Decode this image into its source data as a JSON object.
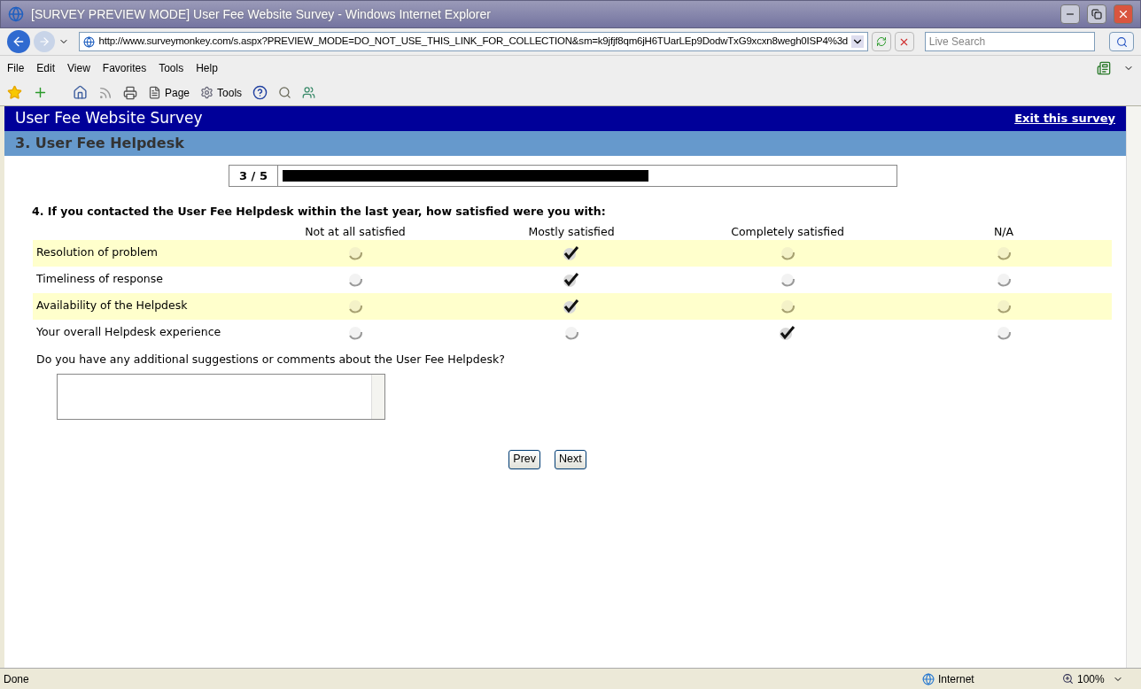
{
  "window": {
    "title": "[SURVEY PREVIEW MODE] User Fee Website Survey - Windows Internet Explorer"
  },
  "address": {
    "url": "http://www.surveymonkey.com/s.aspx?PREVIEW_MODE=DO_NOT_USE_THIS_LINK_FOR_COLLECTION&sm=k9jfjf8qm6jH6TUarLEp9DodwTxG9xcxn8wegh0ISP4%3d"
  },
  "search": {
    "placeholder": "Live Search"
  },
  "menu": [
    "File",
    "Edit",
    "View",
    "Favorites",
    "Tools",
    "Help"
  ],
  "toolbar": [
    {
      "label": "Page"
    },
    {
      "label": "Tools"
    }
  ],
  "survey": {
    "title": "User Fee Website Survey",
    "exit_link": "Exit this survey",
    "section": "3. User Fee Helpdesk",
    "progress": {
      "text": "3 / 5",
      "level": 0.6
    },
    "question": "4. If you contacted the User Fee Helpdesk within the last year, how satisfied were you with:",
    "columns": [
      "Not at all satisfied",
      "Mostly satisfied",
      "Completely satisfied",
      "N/A"
    ],
    "rows": [
      {
        "label": "Resolution of problem",
        "choices": [
          {
            "selected": false
          },
          {
            "selected": true
          },
          {
            "selected": false
          },
          {
            "selected": false
          }
        ]
      },
      {
        "label": "Timeliness of response",
        "choices": [
          {
            "selected": false
          },
          {
            "selected": true
          },
          {
            "selected": false
          },
          {
            "selected": false
          }
        ]
      },
      {
        "label": "Availability of the Helpdesk",
        "choices": [
          {
            "selected": false
          },
          {
            "selected": true
          },
          {
            "selected": false
          },
          {
            "selected": false
          }
        ]
      },
      {
        "label": "Your overall Helpdesk experience",
        "choices": [
          {
            "selected": false
          },
          {
            "selected": false
          },
          {
            "selected": true
          },
          {
            "selected": false
          }
        ]
      }
    ],
    "comment_question": "Do you have any additional suggestions or comments about the User Fee Helpdesk?",
    "buttons": [
      "Prev",
      "Next"
    ]
  },
  "status_bar": {
    "text": "Done",
    "zone": "Internet",
    "zoom": "100%"
  }
}
